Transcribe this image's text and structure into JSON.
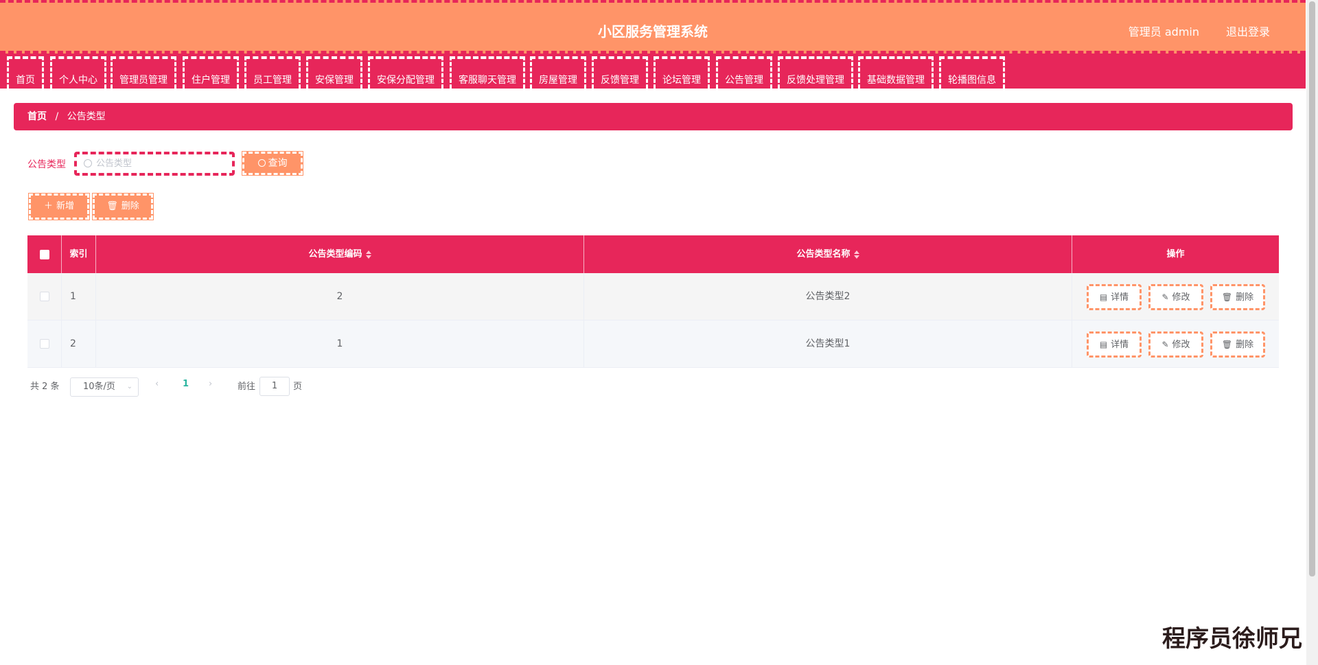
{
  "header": {
    "title": "小区服务管理系统",
    "user": "管理员 admin",
    "logout": "退出登录"
  },
  "nav": [
    {
      "label": "首页"
    },
    {
      "label": "个人中心"
    },
    {
      "label": "管理员管理"
    },
    {
      "label": "住户管理"
    },
    {
      "label": "员工管理"
    },
    {
      "label": "安保管理"
    },
    {
      "label": "安保分配管理"
    },
    {
      "label": "客服聊天管理"
    },
    {
      "label": "房屋管理"
    },
    {
      "label": "反馈管理"
    },
    {
      "label": "论坛管理"
    },
    {
      "label": "公告管理"
    },
    {
      "label": "反馈处理管理"
    },
    {
      "label": "基础数据管理"
    },
    {
      "label": "轮播图信息"
    }
  ],
  "breadcrumb": {
    "home": "首页",
    "separator": "/",
    "current": "公告类型"
  },
  "search": {
    "label": "公告类型",
    "placeholder": "公告类型",
    "value": "",
    "button": "查询"
  },
  "actions": {
    "add": "新增",
    "delete": "删除"
  },
  "table": {
    "headers": {
      "index": "索引",
      "code": "公告类型编码",
      "name": "公告类型名称",
      "ops": "操作"
    },
    "rows": [
      {
        "index": "1",
        "code": "2",
        "name": "公告类型2"
      },
      {
        "index": "2",
        "code": "1",
        "name": "公告类型1"
      }
    ],
    "op_labels": {
      "detail": "详情",
      "edit": "修改",
      "delete": "删除"
    }
  },
  "pagination": {
    "total": "共 2 条",
    "page_size": "10条/页",
    "current_page": "1",
    "goto_prefix": "前往",
    "goto_value": "1",
    "goto_suffix": "页"
  },
  "watermark": "程序员徐师兄",
  "colors": {
    "primary": "#e7265a",
    "accent": "#ff9468"
  }
}
